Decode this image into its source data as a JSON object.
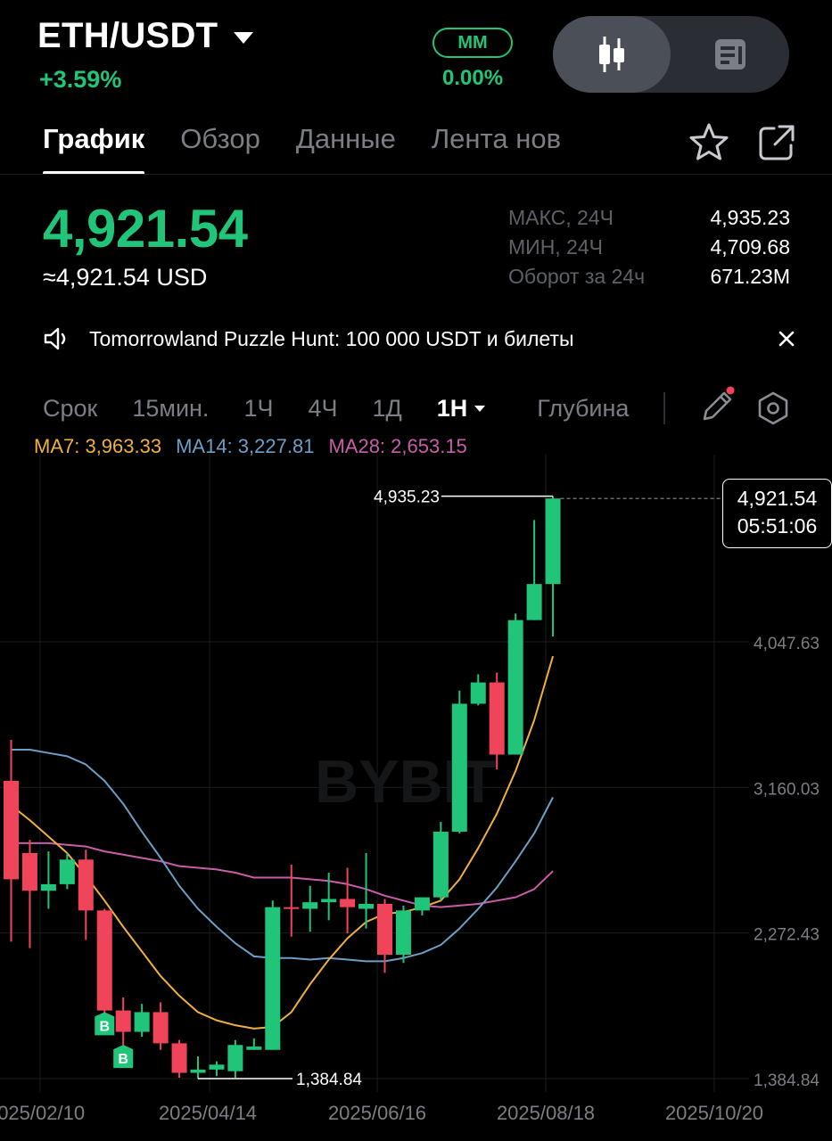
{
  "header": {
    "pair": "ETH/USDT",
    "change": "+3.59%",
    "mm_label": "MM",
    "mm_value": "0.00%"
  },
  "tabs": [
    "График",
    "Обзор",
    "Данные",
    "Лента нов"
  ],
  "price": {
    "last": "4,921.54",
    "usd": "≈4,921.54 USD"
  },
  "stats": [
    {
      "label": "МАКС, 24Ч",
      "value": "4,935.23"
    },
    {
      "label": "МИН, 24Ч",
      "value": "4,709.68"
    },
    {
      "label": "Оборот за 24ч",
      "value": "671.23M"
    }
  ],
  "banner": {
    "text": "Tomorrowland Puzzle Hunt: 100 000 USDT и билеты"
  },
  "timeframes": {
    "items": [
      "Срок",
      "15мин.",
      "1Ч",
      "4Ч",
      "1Д"
    ],
    "selected": "1Н",
    "depth": "Глубина"
  },
  "ma": {
    "ma7": "MA7: 3,963.33",
    "ma14": "MA14: 3,227.81",
    "ma28": "MA28: 2,653.15"
  },
  "colors": {
    "up": "#21c57a",
    "down": "#f0445a",
    "ma7": "#f0b13c",
    "ma14": "#6c9fc6",
    "ma28": "#c95ea8"
  },
  "icons": {
    "toggle_on": "candlestick-icon",
    "toggle_off": "document-icon",
    "favorite": "star-icon",
    "share": "external-link-icon",
    "banner": "speaker-icon",
    "close": "close-icon",
    "draw": "pencil-icon",
    "settings": "hexagon-settings-icon"
  },
  "chart_data": {
    "type": "candlestick",
    "watermark": "BYBIT",
    "y_ticks": [
      "4,047.63",
      "3,160.03",
      "2,272.43",
      "1,384.84"
    ],
    "x_ticks": [
      "2025/02/10",
      "2025/04/14",
      "2025/06/16",
      "2025/08/18",
      "2025/10/20"
    ],
    "high_label": "4,935.23",
    "low_label": "1,384.84",
    "last_price": "4,921.54",
    "countdown": "05:51:06",
    "markers": [
      "B",
      "B"
    ],
    "candles": [
      {
        "o": 3200,
        "h": 3450,
        "l": 2220,
        "c": 2600
      },
      {
        "o": 2760,
        "h": 2840,
        "l": 2180,
        "c": 2530
      },
      {
        "o": 2530,
        "h": 2770,
        "l": 2420,
        "c": 2570
      },
      {
        "o": 2570,
        "h": 2760,
        "l": 2540,
        "c": 2720
      },
      {
        "o": 2720,
        "h": 2780,
        "l": 2230,
        "c": 2410
      },
      {
        "o": 2410,
        "h": 2420,
        "l": 1740,
        "c": 1800
      },
      {
        "o": 1800,
        "h": 1880,
        "l": 1560,
        "c": 1670
      },
      {
        "o": 1670,
        "h": 1840,
        "l": 1640,
        "c": 1790
      },
      {
        "o": 1790,
        "h": 1850,
        "l": 1560,
        "c": 1600
      },
      {
        "o": 1600,
        "h": 1620,
        "l": 1390,
        "c": 1420
      },
      {
        "o": 1420,
        "h": 1520,
        "l": 1384.84,
        "c": 1440
      },
      {
        "o": 1440,
        "h": 1490,
        "l": 1400,
        "c": 1470
      },
      {
        "o": 1430,
        "h": 1620,
        "l": 1390,
        "c": 1590
      },
      {
        "o": 1560,
        "h": 1630,
        "l": 1560,
        "c": 1580
      },
      {
        "o": 1560,
        "h": 2470,
        "l": 1560,
        "c": 2430
      },
      {
        "o": 2430,
        "h": 2690,
        "l": 2250,
        "c": 2420
      },
      {
        "o": 2420,
        "h": 2560,
        "l": 2280,
        "c": 2460
      },
      {
        "o": 2460,
        "h": 2640,
        "l": 2350,
        "c": 2480
      },
      {
        "o": 2480,
        "h": 2670,
        "l": 2270,
        "c": 2430
      },
      {
        "o": 2420,
        "h": 2760,
        "l": 2300,
        "c": 2450
      },
      {
        "o": 2450,
        "h": 2480,
        "l": 2030,
        "c": 2140
      },
      {
        "o": 2140,
        "h": 2440,
        "l": 2090,
        "c": 2410
      },
      {
        "o": 2410,
        "h": 2480,
        "l": 2380,
        "c": 2490
      },
      {
        "o": 2490,
        "h": 2950,
        "l": 2470,
        "c": 2890
      },
      {
        "o": 2890,
        "h": 3750,
        "l": 2880,
        "c": 3670
      },
      {
        "o": 3670,
        "h": 3850,
        "l": 3660,
        "c": 3800
      },
      {
        "o": 3800,
        "h": 3860,
        "l": 3270,
        "c": 3360
      },
      {
        "o": 3360,
        "h": 4220,
        "l": 3360,
        "c": 4180
      },
      {
        "o": 4180,
        "h": 4790,
        "l": 4180,
        "c": 4400
      },
      {
        "o": 4400,
        "h": 4935.23,
        "l": 4080,
        "c": 4921.54
      }
    ],
    "ma7": [
      3050,
      2960,
      2860,
      2760,
      2620,
      2470,
      2310,
      2160,
      2010,
      1890,
      1790,
      1740,
      1710,
      1690,
      1700,
      1790,
      1960,
      2110,
      2240,
      2340,
      2390,
      2400,
      2430,
      2470,
      2600,
      2790,
      3000,
      3260,
      3570,
      3960
    ],
    "ma14": [
      3390,
      3390,
      3370,
      3350,
      3300,
      3200,
      3060,
      2890,
      2730,
      2560,
      2420,
      2310,
      2210,
      2130,
      2120,
      2120,
      2110,
      2120,
      2110,
      2100,
      2100,
      2120,
      2150,
      2200,
      2300,
      2420,
      2550,
      2710,
      2880,
      3100
    ],
    "ma28": [
      2820,
      2820,
      2820,
      2810,
      2800,
      2770,
      2750,
      2730,
      2710,
      2680,
      2670,
      2660,
      2640,
      2610,
      2610,
      2610,
      2600,
      2590,
      2570,
      2540,
      2500,
      2470,
      2440,
      2430,
      2440,
      2450,
      2470,
      2490,
      2540,
      2650
    ]
  }
}
